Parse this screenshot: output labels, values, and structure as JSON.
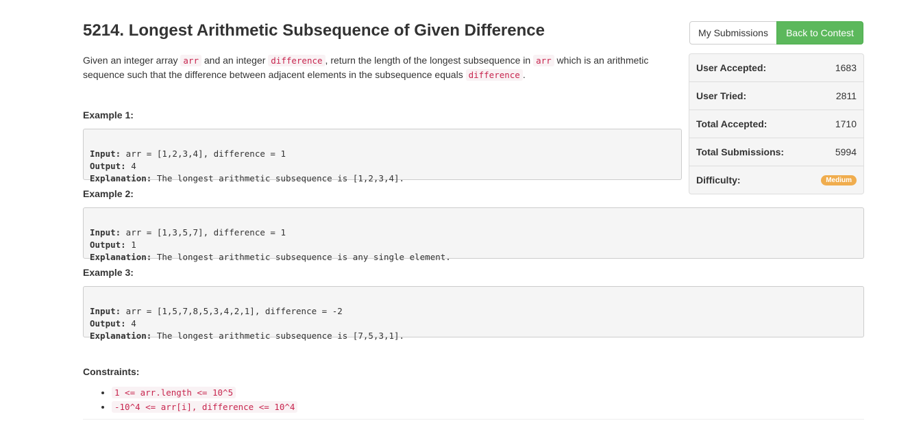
{
  "problem": {
    "title": "5214. Longest Arithmetic Subsequence of Given Difference",
    "description": {
      "t1": "Given an integer array ",
      "c1": "arr",
      "t2": " and an integer ",
      "c2": "difference",
      "t3": ", return the length of the longest subsequence in ",
      "c3": "arr",
      "t4": " which is an arithmetic sequence such that the difference between adjacent elements in the subsequence equals ",
      "c4": "difference",
      "t5": "."
    },
    "examples": [
      {
        "label": "Example 1:",
        "input_label": "Input:",
        "input": " arr = [1,2,3,4], difference = 1",
        "output_label": "Output:",
        "output": " 4",
        "explanation_label": "Explanation:",
        "explanation": " The longest arithmetic subsequence is [1,2,3,4]."
      },
      {
        "label": "Example 2:",
        "input_label": "Input:",
        "input": " arr = [1,3,5,7], difference = 1",
        "output_label": "Output:",
        "output": " 1",
        "explanation_label": "Explanation:",
        "explanation": " The longest arithmetic subsequence is any single element."
      },
      {
        "label": "Example 3:",
        "input_label": "Input:",
        "input": " arr = [1,5,7,8,5,3,4,2,1], difference = -2",
        "output_label": "Output:",
        "output": " 4",
        "explanation_label": "Explanation:",
        "explanation": " The longest arithmetic subsequence is [7,5,3,1]."
      }
    ],
    "constraints_label": "Constraints:",
    "constraints": [
      "1 <= arr.length <= 10^5",
      "-10^4 <= arr[i], difference <= 10^4"
    ]
  },
  "actions": {
    "my_submissions": "My Submissions",
    "back_to_contest": "Back to Contest"
  },
  "stats": [
    {
      "label": "User Accepted:",
      "value": "1683"
    },
    {
      "label": "User Tried:",
      "value": "2811"
    },
    {
      "label": "Total Accepted:",
      "value": "1710"
    },
    {
      "label": "Total Submissions:",
      "value": "5994"
    },
    {
      "label": "Difficulty:",
      "value": "Medium"
    }
  ],
  "colors": {
    "accent_green": "#5cb85c",
    "difficulty_medium": "#f0ad4e",
    "code_text": "#c7254e"
  }
}
